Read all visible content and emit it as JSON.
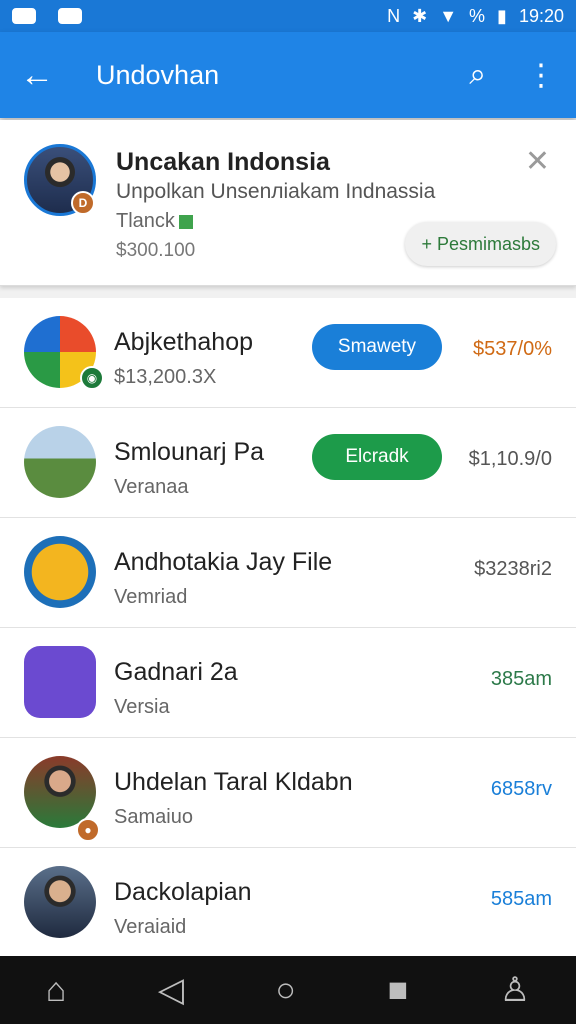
{
  "status_bar": {
    "time": "19:20",
    "battery_text": "%"
  },
  "app_bar": {
    "title": "Undovhan",
    "back_icon": "arrow-left-icon",
    "search_icon": "search-icon",
    "menu_icon": "more-vert-icon"
  },
  "header_card": {
    "title": "Uncakan Indonsia",
    "subtitle": "Unpolkan Unsenлiakam Indnassia",
    "tag": "Tlanck",
    "amount": "$300.100",
    "permission_button": "+ Pesmimasbs",
    "close_icon": "close-icon"
  },
  "rows": [
    {
      "name": "Abjkethahop",
      "meta": "$13,200.3X",
      "button": "Smawety",
      "button_color": "#1a7fd8",
      "amount": "$537/0%",
      "amount_color": "#d06a14"
    },
    {
      "name": "Smlounarj  Pa",
      "meta": "Veranaa",
      "button": "Elcradk",
      "button_color": "#1d9b4a",
      "amount": "$1,10.9/0",
      "amount_color": "#555555"
    },
    {
      "name": "Andhotakia Jay File",
      "meta": "Vemriad",
      "button": "",
      "button_color": "",
      "amount": "$3238ri2",
      "amount_color": "#555555"
    },
    {
      "name": "Gadnari 2a",
      "meta": "Versia",
      "button": "",
      "button_color": "",
      "amount": "385am",
      "amount_color": "#2d7a4a"
    },
    {
      "name": "Uhdelan Taral Kldabn",
      "meta": "Samaiuo",
      "button": "",
      "button_color": "",
      "amount": "6858rv",
      "amount_color": "#1a7fd8"
    },
    {
      "name": "Dackolapian",
      "meta": "Veraiaid",
      "button": "",
      "button_color": "",
      "amount": "585am",
      "amount_color": "#1a7fd8"
    }
  ],
  "nav": {
    "home": "home-icon",
    "back": "back-icon",
    "circle": "home-circle-icon",
    "recent": "recent-icon",
    "profile": "profile-icon"
  }
}
